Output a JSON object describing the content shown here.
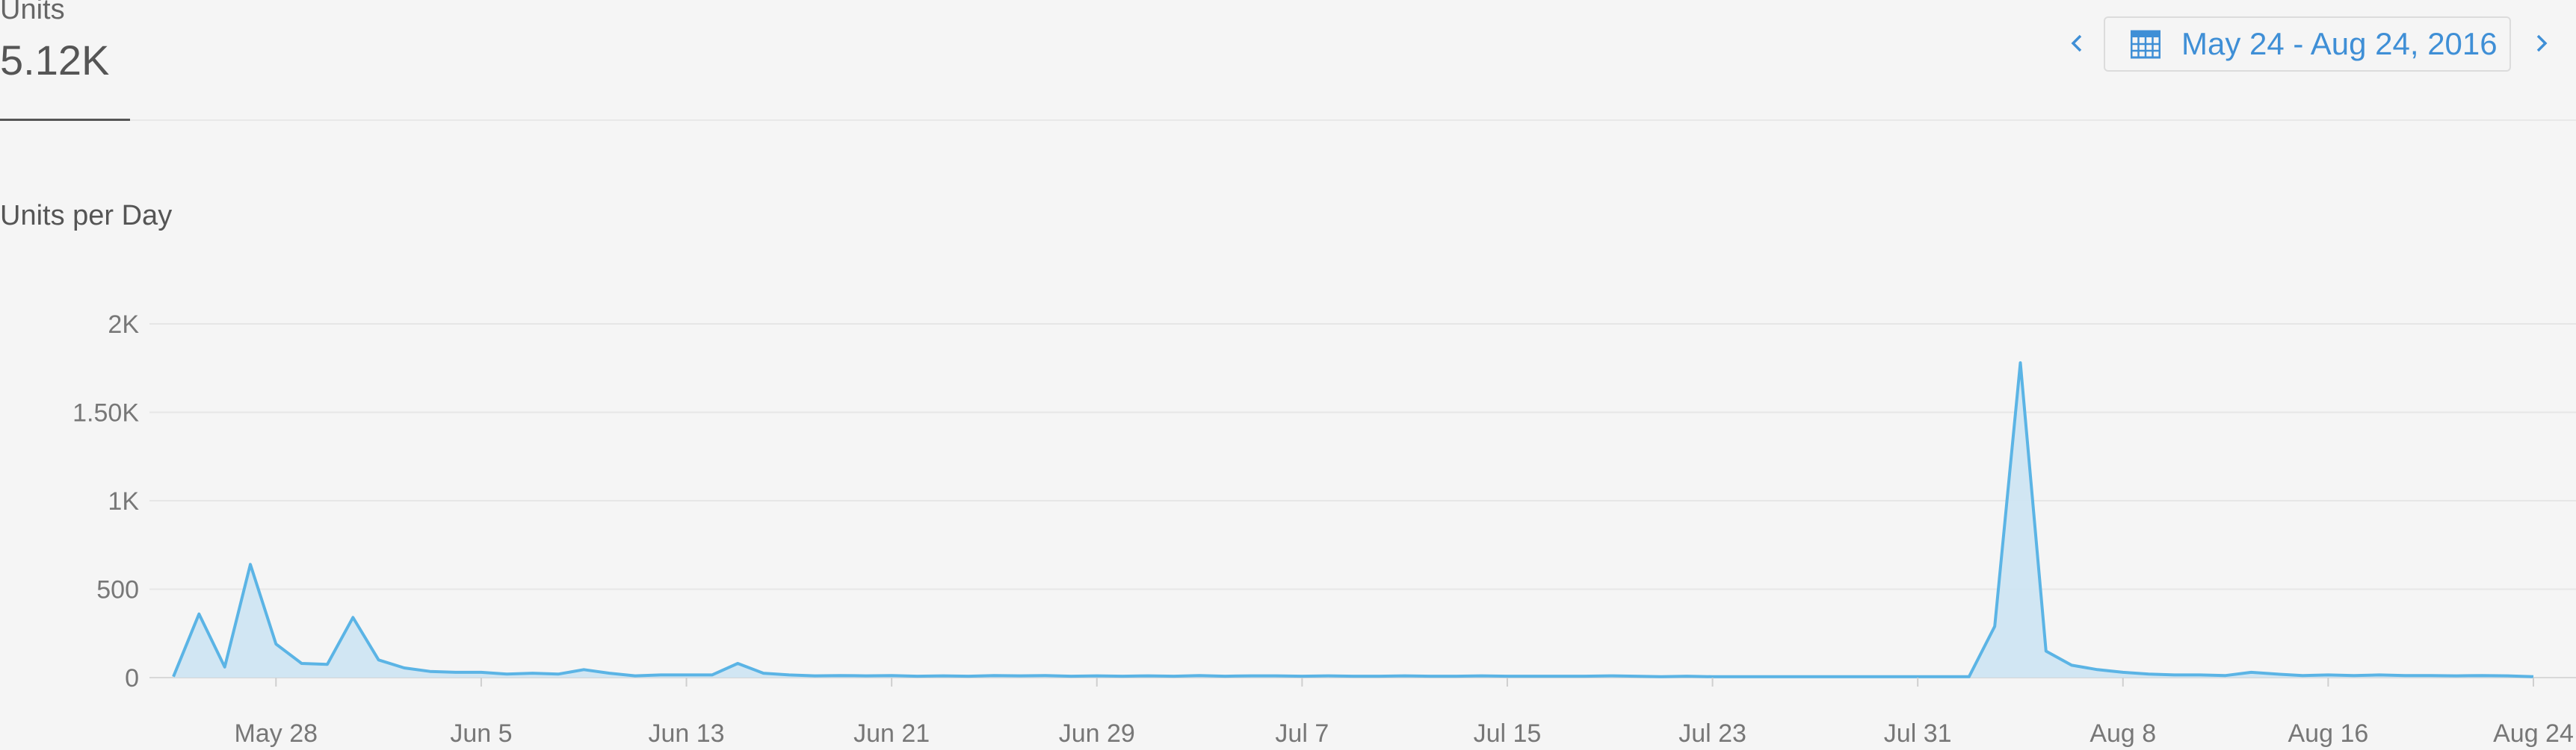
{
  "summary": {
    "metric_label": "Units",
    "metric_value": "5.12K"
  },
  "date_range": {
    "label": "May 24 - Aug 24, 2016",
    "prev_icon": "chevron-left-icon",
    "next_icon": "chevron-right-icon",
    "calendar_icon": "calendar-icon"
  },
  "colors": {
    "accent": "#3f8fd6",
    "line": "#5bb4e5",
    "fill": "#cde4f3"
  },
  "chart_data": {
    "type": "area",
    "title": "Units per Day",
    "xlabel": "",
    "ylabel": "",
    "ylim": [
      0,
      2000
    ],
    "yticks": [
      {
        "value": 0,
        "label": "0"
      },
      {
        "value": 500,
        "label": "500"
      },
      {
        "value": 1000,
        "label": "1K"
      },
      {
        "value": 1500,
        "label": "1.50K"
      },
      {
        "value": 2000,
        "label": "2K"
      }
    ],
    "xticks": [
      {
        "date": "2016-05-28",
        "label": "May 28"
      },
      {
        "date": "2016-06-05",
        "label": "Jun 5"
      },
      {
        "date": "2016-06-13",
        "label": "Jun 13"
      },
      {
        "date": "2016-06-21",
        "label": "Jun 21"
      },
      {
        "date": "2016-06-29",
        "label": "Jun 29"
      },
      {
        "date": "2016-07-07",
        "label": "Jul 7"
      },
      {
        "date": "2016-07-15",
        "label": "Jul 15"
      },
      {
        "date": "2016-07-23",
        "label": "Jul 23"
      },
      {
        "date": "2016-07-31",
        "label": "Jul 31"
      },
      {
        "date": "2016-08-08",
        "label": "Aug 8"
      },
      {
        "date": "2016-08-16",
        "label": "Aug 16"
      },
      {
        "date": "2016-08-24",
        "label": "Aug 24"
      }
    ],
    "grid": true,
    "series": [
      {
        "x": [
          "2016-05-24",
          "2016-05-25",
          "2016-05-26",
          "2016-05-27",
          "2016-05-28",
          "2016-05-29",
          "2016-05-30",
          "2016-05-31",
          "2016-06-01",
          "2016-06-02",
          "2016-06-03",
          "2016-06-04",
          "2016-06-05",
          "2016-06-06",
          "2016-06-07",
          "2016-06-08",
          "2016-06-09",
          "2016-06-10",
          "2016-06-11",
          "2016-06-12",
          "2016-06-13",
          "2016-06-14",
          "2016-06-15",
          "2016-06-16",
          "2016-06-17",
          "2016-06-18",
          "2016-06-19",
          "2016-06-20",
          "2016-06-21",
          "2016-06-22",
          "2016-06-23",
          "2016-06-24",
          "2016-06-25",
          "2016-06-26",
          "2016-06-27",
          "2016-06-28",
          "2016-06-29",
          "2016-06-30",
          "2016-07-01",
          "2016-07-02",
          "2016-07-03",
          "2016-07-04",
          "2016-07-05",
          "2016-07-06",
          "2016-07-07",
          "2016-07-08",
          "2016-07-09",
          "2016-07-10",
          "2016-07-11",
          "2016-07-12",
          "2016-07-13",
          "2016-07-14",
          "2016-07-15",
          "2016-07-16",
          "2016-07-17",
          "2016-07-18",
          "2016-07-19",
          "2016-07-20",
          "2016-07-21",
          "2016-07-22",
          "2016-07-23",
          "2016-07-24",
          "2016-07-25",
          "2016-07-26",
          "2016-07-27",
          "2016-07-28",
          "2016-07-29",
          "2016-07-30",
          "2016-07-31",
          "2016-08-01",
          "2016-08-02",
          "2016-08-03",
          "2016-08-04",
          "2016-08-05",
          "2016-08-06",
          "2016-08-07",
          "2016-08-08",
          "2016-08-09",
          "2016-08-10",
          "2016-08-11",
          "2016-08-12",
          "2016-08-13",
          "2016-08-14",
          "2016-08-15",
          "2016-08-16",
          "2016-08-17",
          "2016-08-18",
          "2016-08-19",
          "2016-08-20",
          "2016-08-21",
          "2016-08-22",
          "2016-08-23",
          "2016-08-24"
        ],
        "values": [
          5,
          360,
          60,
          640,
          190,
          80,
          75,
          340,
          100,
          55,
          35,
          30,
          30,
          20,
          25,
          20,
          45,
          25,
          10,
          15,
          15,
          15,
          80,
          25,
          15,
          10,
          12,
          10,
          12,
          8,
          10,
          8,
          12,
          10,
          12,
          8,
          10,
          8,
          10,
          8,
          12,
          8,
          10,
          10,
          8,
          10,
          8,
          8,
          10,
          8,
          8,
          10,
          8,
          8,
          8,
          8,
          10,
          8,
          5,
          8,
          5,
          5,
          5,
          5,
          5,
          5,
          5,
          5,
          5,
          5,
          5,
          290,
          1780,
          150,
          70,
          45,
          30,
          20,
          15,
          15,
          12,
          30,
          20,
          12,
          15,
          12,
          15,
          12,
          12,
          10,
          12,
          10,
          5
        ]
      }
    ]
  }
}
